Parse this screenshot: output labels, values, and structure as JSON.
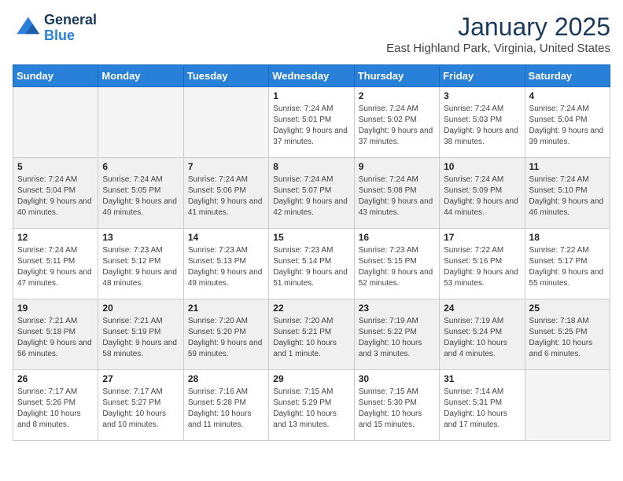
{
  "header": {
    "logo_line1": "General",
    "logo_line2": "Blue",
    "month": "January 2025",
    "location": "East Highland Park, Virginia, United States"
  },
  "columns": [
    "Sunday",
    "Monday",
    "Tuesday",
    "Wednesday",
    "Thursday",
    "Friday",
    "Saturday"
  ],
  "weeks": [
    {
      "shaded": false,
      "days": [
        {
          "num": "",
          "info": ""
        },
        {
          "num": "",
          "info": ""
        },
        {
          "num": "",
          "info": ""
        },
        {
          "num": "1",
          "info": "Sunrise: 7:24 AM\nSunset: 5:01 PM\nDaylight: 9 hours\nand 37 minutes."
        },
        {
          "num": "2",
          "info": "Sunrise: 7:24 AM\nSunset: 5:02 PM\nDaylight: 9 hours\nand 37 minutes."
        },
        {
          "num": "3",
          "info": "Sunrise: 7:24 AM\nSunset: 5:03 PM\nDaylight: 9 hours\nand 38 minutes."
        },
        {
          "num": "4",
          "info": "Sunrise: 7:24 AM\nSunset: 5:04 PM\nDaylight: 9 hours\nand 39 minutes."
        }
      ]
    },
    {
      "shaded": true,
      "days": [
        {
          "num": "5",
          "info": "Sunrise: 7:24 AM\nSunset: 5:04 PM\nDaylight: 9 hours\nand 40 minutes."
        },
        {
          "num": "6",
          "info": "Sunrise: 7:24 AM\nSunset: 5:05 PM\nDaylight: 9 hours\nand 40 minutes."
        },
        {
          "num": "7",
          "info": "Sunrise: 7:24 AM\nSunset: 5:06 PM\nDaylight: 9 hours\nand 41 minutes."
        },
        {
          "num": "8",
          "info": "Sunrise: 7:24 AM\nSunset: 5:07 PM\nDaylight: 9 hours\nand 42 minutes."
        },
        {
          "num": "9",
          "info": "Sunrise: 7:24 AM\nSunset: 5:08 PM\nDaylight: 9 hours\nand 43 minutes."
        },
        {
          "num": "10",
          "info": "Sunrise: 7:24 AM\nSunset: 5:09 PM\nDaylight: 9 hours\nand 44 minutes."
        },
        {
          "num": "11",
          "info": "Sunrise: 7:24 AM\nSunset: 5:10 PM\nDaylight: 9 hours\nand 46 minutes."
        }
      ]
    },
    {
      "shaded": false,
      "days": [
        {
          "num": "12",
          "info": "Sunrise: 7:24 AM\nSunset: 5:11 PM\nDaylight: 9 hours\nand 47 minutes."
        },
        {
          "num": "13",
          "info": "Sunrise: 7:23 AM\nSunset: 5:12 PM\nDaylight: 9 hours\nand 48 minutes."
        },
        {
          "num": "14",
          "info": "Sunrise: 7:23 AM\nSunset: 5:13 PM\nDaylight: 9 hours\nand 49 minutes."
        },
        {
          "num": "15",
          "info": "Sunrise: 7:23 AM\nSunset: 5:14 PM\nDaylight: 9 hours\nand 51 minutes."
        },
        {
          "num": "16",
          "info": "Sunrise: 7:23 AM\nSunset: 5:15 PM\nDaylight: 9 hours\nand 52 minutes."
        },
        {
          "num": "17",
          "info": "Sunrise: 7:22 AM\nSunset: 5:16 PM\nDaylight: 9 hours\nand 53 minutes."
        },
        {
          "num": "18",
          "info": "Sunrise: 7:22 AM\nSunset: 5:17 PM\nDaylight: 9 hours\nand 55 minutes."
        }
      ]
    },
    {
      "shaded": true,
      "days": [
        {
          "num": "19",
          "info": "Sunrise: 7:21 AM\nSunset: 5:18 PM\nDaylight: 9 hours\nand 56 minutes."
        },
        {
          "num": "20",
          "info": "Sunrise: 7:21 AM\nSunset: 5:19 PM\nDaylight: 9 hours\nand 58 minutes."
        },
        {
          "num": "21",
          "info": "Sunrise: 7:20 AM\nSunset: 5:20 PM\nDaylight: 9 hours\nand 59 minutes."
        },
        {
          "num": "22",
          "info": "Sunrise: 7:20 AM\nSunset: 5:21 PM\nDaylight: 10 hours\nand 1 minute."
        },
        {
          "num": "23",
          "info": "Sunrise: 7:19 AM\nSunset: 5:22 PM\nDaylight: 10 hours\nand 3 minutes."
        },
        {
          "num": "24",
          "info": "Sunrise: 7:19 AM\nSunset: 5:24 PM\nDaylight: 10 hours\nand 4 minutes."
        },
        {
          "num": "25",
          "info": "Sunrise: 7:18 AM\nSunset: 5:25 PM\nDaylight: 10 hours\nand 6 minutes."
        }
      ]
    },
    {
      "shaded": false,
      "days": [
        {
          "num": "26",
          "info": "Sunrise: 7:17 AM\nSunset: 5:26 PM\nDaylight: 10 hours\nand 8 minutes."
        },
        {
          "num": "27",
          "info": "Sunrise: 7:17 AM\nSunset: 5:27 PM\nDaylight: 10 hours\nand 10 minutes."
        },
        {
          "num": "28",
          "info": "Sunrise: 7:16 AM\nSunset: 5:28 PM\nDaylight: 10 hours\nand 11 minutes."
        },
        {
          "num": "29",
          "info": "Sunrise: 7:15 AM\nSunset: 5:29 PM\nDaylight: 10 hours\nand 13 minutes."
        },
        {
          "num": "30",
          "info": "Sunrise: 7:15 AM\nSunset: 5:30 PM\nDaylight: 10 hours\nand 15 minutes."
        },
        {
          "num": "31",
          "info": "Sunrise: 7:14 AM\nSunset: 5:31 PM\nDaylight: 10 hours\nand 17 minutes."
        },
        {
          "num": "",
          "info": ""
        }
      ]
    }
  ]
}
